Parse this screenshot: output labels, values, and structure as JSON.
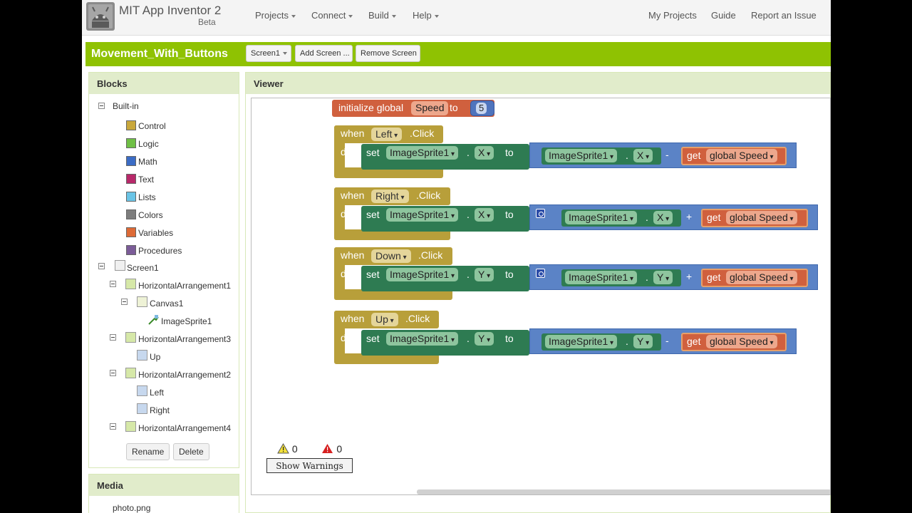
{
  "app": {
    "title": "MIT App Inventor 2",
    "subtitle": "Beta"
  },
  "nav": {
    "left": [
      {
        "label": "Projects"
      },
      {
        "label": "Connect"
      },
      {
        "label": "Build"
      },
      {
        "label": "Help"
      }
    ],
    "right": [
      {
        "label": "My Projects"
      },
      {
        "label": "Guide"
      },
      {
        "label": "Report an Issue"
      }
    ]
  },
  "project": {
    "name": "Movement_With_Buttons",
    "screen_select": "Screen1",
    "add_screen": "Add Screen ...",
    "remove_screen": "Remove Screen"
  },
  "blocks_panel": {
    "title": "Blocks",
    "builtin": {
      "label": "Built-in",
      "items": [
        {
          "label": "Control",
          "color": "#c9a83c"
        },
        {
          "label": "Logic",
          "color": "#6fbf45"
        },
        {
          "label": "Math",
          "color": "#3b6cc5"
        },
        {
          "label": "Text",
          "color": "#b8286a"
        },
        {
          "label": "Lists",
          "color": "#6ac4e6"
        },
        {
          "label": "Colors",
          "color": "#7d7d7d"
        },
        {
          "label": "Variables",
          "color": "#dd6a36"
        },
        {
          "label": "Procedures",
          "color": "#7b5c98"
        }
      ]
    },
    "components": {
      "screen": "Screen1",
      "ha1": "HorizontalArrangement1",
      "canvas": "Canvas1",
      "sprite": "ImageSprite1",
      "ha3": "HorizontalArrangement3",
      "up": "Up",
      "ha2": "HorizontalArrangement2",
      "left": "Left",
      "right": "Right",
      "ha4": "HorizontalArrangement4"
    },
    "rename": "Rename",
    "delete": "Delete"
  },
  "media_panel": {
    "title": "Media",
    "items": [
      "photo.png"
    ]
  },
  "viewer": {
    "title": "Viewer",
    "init": {
      "prefix": "initialize global",
      "var": "Speed",
      "to": "to",
      "value": "5"
    },
    "kw": {
      "when": "when",
      "do": "do",
      "click": ".Click",
      "set": "set",
      "to": "to",
      "dot": ".",
      "get": "get",
      "var": "global Speed",
      "sprite": "ImageSprite1",
      "minus": "-",
      "plus": "+",
      "x": "X",
      "y": "Y"
    },
    "events": {
      "left": "Left",
      "right": "Right",
      "down": "Down",
      "up": "Up"
    },
    "warnings": {
      "warn_count": "0",
      "error_count": "0",
      "show_label": "Show Warnings"
    }
  }
}
